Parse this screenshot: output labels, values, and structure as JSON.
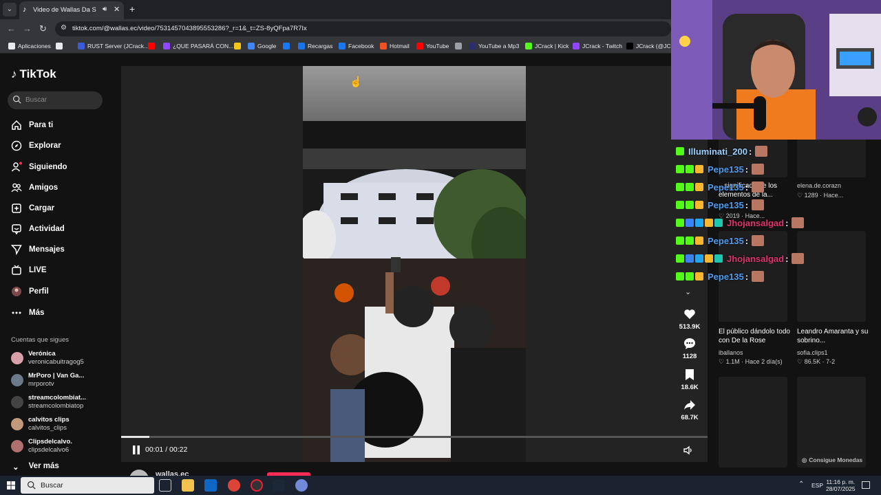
{
  "browser": {
    "tab_title": "Video de Wallas Da Silva (@",
    "url": "tiktok.com/@wallas.ec/video/7531457043895553286?_r=1&_t=ZS-8yQFpa7R7Ix",
    "bookmarks": [
      {
        "label": "Aplicaciones",
        "color": "#e8eaed"
      },
      {
        "label": "",
        "color": "#e8eaed"
      },
      {
        "label": "RUST Server (JCrack...",
        "color": "#3b5bdb"
      },
      {
        "label": "",
        "color": "#ff0000"
      },
      {
        "label": "¿QUE PASARÁ CON...",
        "color": "#9146ff"
      },
      {
        "label": "",
        "color": "#f5c518"
      },
      {
        "label": "Google",
        "color": "#4285f4"
      },
      {
        "label": "",
        "color": "#1877f2"
      },
      {
        "label": "Recargas",
        "color": "#1a73e8"
      },
      {
        "label": "Facebook",
        "color": "#1877f2"
      },
      {
        "label": "Hotmail",
        "color": "#f25022"
      },
      {
        "label": "YouTube",
        "color": "#ff0000"
      },
      {
        "label": "",
        "color": "#9aa0a6"
      },
      {
        "label": "YouTube a Mp3",
        "color": "#2d2d6b"
      },
      {
        "label": "JCrack | Kick",
        "color": "#53fc18"
      },
      {
        "label": "JCrack - Twitch",
        "color": "#9146ff"
      },
      {
        "label": "JCrack (@JCra",
        "color": "#000000"
      }
    ]
  },
  "sidebar": {
    "logo": "TikTok",
    "search_placeholder": "Buscar",
    "items": [
      {
        "label": "Para ti",
        "icon": "home-icon"
      },
      {
        "label": "Explorar",
        "icon": "compass-icon"
      },
      {
        "label": "Siguiendo",
        "icon": "following-icon"
      },
      {
        "label": "Amigos",
        "icon": "friends-icon"
      },
      {
        "label": "Cargar",
        "icon": "upload-icon"
      },
      {
        "label": "Actividad",
        "icon": "activity-icon"
      },
      {
        "label": "Mensajes",
        "icon": "messages-icon"
      },
      {
        "label": "LIVE",
        "icon": "live-icon"
      },
      {
        "label": "Perfil",
        "icon": "profile-icon"
      },
      {
        "label": "Más",
        "icon": "more-icon"
      }
    ],
    "following_title": "Cuentas que sigues",
    "following": [
      {
        "name": "Verónica",
        "handle": "veronicabuitragog5"
      },
      {
        "name": "MrPoro | Van Ga...",
        "handle": "mrporotv"
      },
      {
        "name": "streamcolombiat...",
        "handle": "streamcolombiatop"
      },
      {
        "name": "calvitos clips",
        "handle": "calvitos_clips"
      },
      {
        "name": "Clipsdelcalvo.",
        "handle": "clipsdelcalvo6"
      }
    ],
    "see_more": "Ver más"
  },
  "player": {
    "time": "00:01 / 00:22",
    "progress": 0.048,
    "author": "wallas.ec"
  },
  "actions": {
    "likes": "513.9K",
    "comments": "1128",
    "saves": "18.6K",
    "shares": "68.7K"
  },
  "chat": [
    {
      "user": "Illuminati_200",
      "color": "#9ad1ff",
      "badges": [
        "#53fc18"
      ]
    },
    {
      "user": "Pepe135",
      "color": "#4f9cf0",
      "badges": [
        "#53fc18",
        "#53fc18",
        "#f5b82e"
      ]
    },
    {
      "user": "Pepe135",
      "color": "#4f9cf0",
      "badges": [
        "#53fc18",
        "#53fc18",
        "#f5b82e"
      ]
    },
    {
      "user": "Pepe135",
      "color": "#4f9cf0",
      "badges": [
        "#53fc18",
        "#53fc18",
        "#f5b82e"
      ]
    },
    {
      "user": "Jhojansalgad",
      "color": "#e0336b",
      "badges": [
        "#53fc18",
        "#3b82f6",
        "#22a6f2",
        "#f5b82e",
        "#1ec7b0"
      ]
    },
    {
      "user": "Pepe135",
      "color": "#4f9cf0",
      "badges": [
        "#53fc18",
        "#53fc18",
        "#f5b82e"
      ]
    },
    {
      "user": "Jhojansalgad",
      "color": "#e0336b",
      "badges": [
        "#53fc18",
        "#3b82f6",
        "#22a6f2",
        "#f5b82e",
        "#1ec7b0"
      ]
    },
    {
      "user": "Pepe135",
      "color": "#4f9cf0",
      "badges": [
        "#53fc18",
        "#53fc18",
        "#f5b82e"
      ]
    }
  ],
  "cards": [
    {
      "title": "...significado de los elementos de la...",
      "meta": "♡ 2019 · Hace..."
    },
    {
      "title": "",
      "meta": "♡ 1289 · Hace..."
    },
    {
      "title": "El público dándolo todo con De la Rose",
      "user": "iballanos",
      "meta": "♡ 1.1M · Hace 2 día(s)"
    },
    {
      "title": "Leandro Amaranta y su sobrino...",
      "user": "sofia.clips1",
      "meta": "♡ 86.5K · 7-2"
    }
  ],
  "card_top_user": "elena.de.corazn",
  "coins_button": "Consigue Monedas",
  "taskbar": {
    "search": "Buscar",
    "lang": "ESP",
    "time": "11:16 p. m.",
    "date": "28/07/2025"
  }
}
